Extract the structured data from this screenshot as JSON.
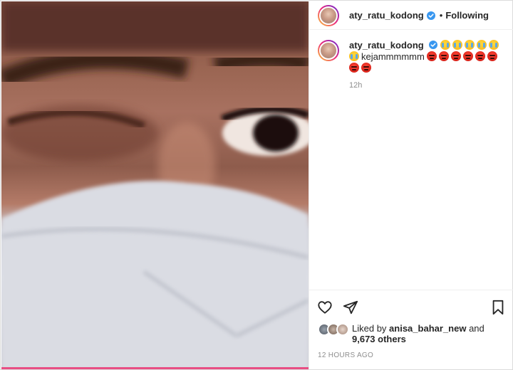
{
  "post": {
    "username": "aty_ratu_kodong",
    "follow_status": "Following",
    "separator": "•"
  },
  "caption": {
    "username": "aty_ratu_kodong",
    "text": "kejammmmmm",
    "emoji_before": [
      "crying-face",
      "crying-face",
      "crying-face",
      "crying-face",
      "crying-face",
      "crying-face"
    ],
    "emoji_after": [
      "angry-face",
      "angry-face",
      "angry-face",
      "angry-face",
      "angry-face",
      "angry-face",
      "angry-face",
      "angry-face"
    ],
    "time_ago": "12h"
  },
  "likes": {
    "prefix": "Liked by",
    "liker": "anisa_bahar_new",
    "conjunction": "and",
    "others": "9,673 others"
  },
  "timestamp": "12 HOURS AGO",
  "colors": {
    "verified": "#3897f0",
    "story_ring": "#ee2a7b",
    "secondary_text": "#8e8e8e"
  }
}
